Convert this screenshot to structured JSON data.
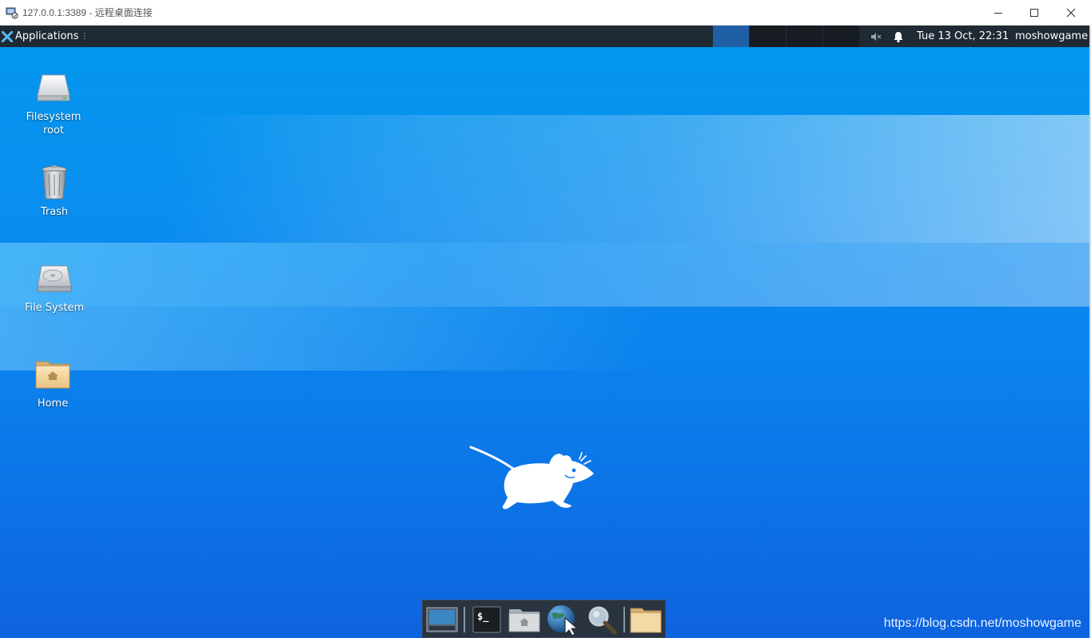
{
  "window": {
    "title": "127.0.0.1:3389 - 远程桌面连接",
    "icon": "remote-desktop-icon",
    "controls": [
      "minimize",
      "maximize",
      "close"
    ]
  },
  "panel": {
    "applications_label": "Applications",
    "grip": "⋮",
    "workspaces": [
      {
        "index": 1,
        "active": true
      },
      {
        "index": 2,
        "active": false
      },
      {
        "index": 3,
        "active": false
      },
      {
        "index": 4,
        "active": false
      }
    ],
    "tray_icons": [
      "volume-muted-icon",
      "notifications-bell-icon"
    ],
    "clock": "Tue 13 Oct, 22:31",
    "user": "moshowgame"
  },
  "desktop_icons": [
    {
      "label": "Filesystem root",
      "icon": "drive-icon"
    },
    {
      "label": "Trash",
      "icon": "trash-icon"
    },
    {
      "label": "File System",
      "icon": "hard-disk-icon"
    },
    {
      "label": "Home",
      "icon": "home-folder-icon"
    }
  ],
  "dock": {
    "items": [
      "show-desktop-icon",
      "terminal-icon",
      "file-manager-icon",
      "web-browser-icon",
      "search-icon",
      "folder-icon"
    ],
    "terminal_prompt": "$_"
  },
  "watermark": "https://blog.csdn.net/moshowgame",
  "colors": {
    "panel_bg": "#1f2a35",
    "desktop_top": "#0297ec",
    "desktop_bottom": "#0e63de",
    "active_workspace": "#1f5fa6"
  }
}
